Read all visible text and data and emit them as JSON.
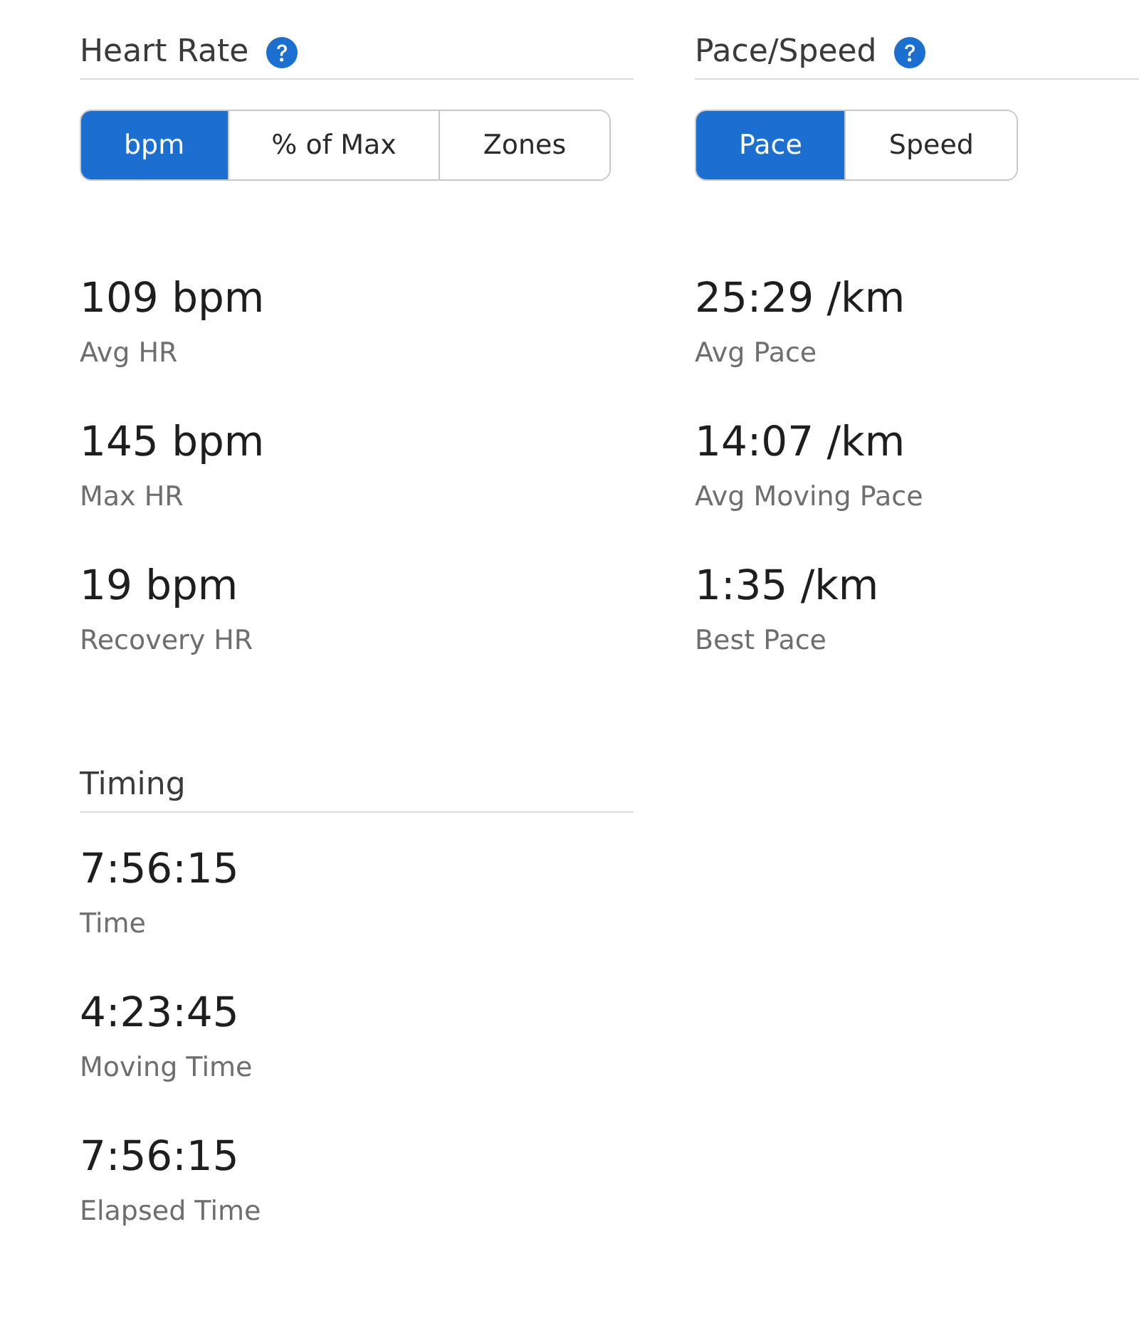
{
  "columns": [
    {
      "sections": [
        {
          "title": "Heart Rate",
          "help_icon": true,
          "toggle": [
            {
              "label": "bpm",
              "selected": true
            },
            {
              "label": "% of Max",
              "selected": false
            },
            {
              "label": "Zones",
              "selected": false
            }
          ],
          "stats": [
            {
              "value": "109 bpm",
              "label": "Avg HR"
            },
            {
              "value": "145 bpm",
              "label": "Max HR"
            },
            {
              "value": "19 bpm",
              "label": "Recovery HR"
            }
          ]
        },
        {
          "title": "Timing",
          "help_icon": false,
          "stats": [
            {
              "value": "7:56:15",
              "label": "Time"
            },
            {
              "value": "4:23:45",
              "label": "Moving Time"
            },
            {
              "value": "7:56:15",
              "label": "Elapsed Time"
            }
          ]
        }
      ]
    },
    {
      "sections": [
        {
          "title": "Pace/Speed",
          "help_icon": true,
          "toggle": [
            {
              "label": "Pace",
              "selected": true
            },
            {
              "label": "Speed",
              "selected": false
            }
          ],
          "stats": [
            {
              "value": "25:29 /km",
              "label": "Avg Pace"
            },
            {
              "value": "14:07 /km",
              "label": "Avg Moving Pace"
            },
            {
              "value": "1:35 /km",
              "label": "Best Pace"
            }
          ]
        }
      ]
    }
  ]
}
